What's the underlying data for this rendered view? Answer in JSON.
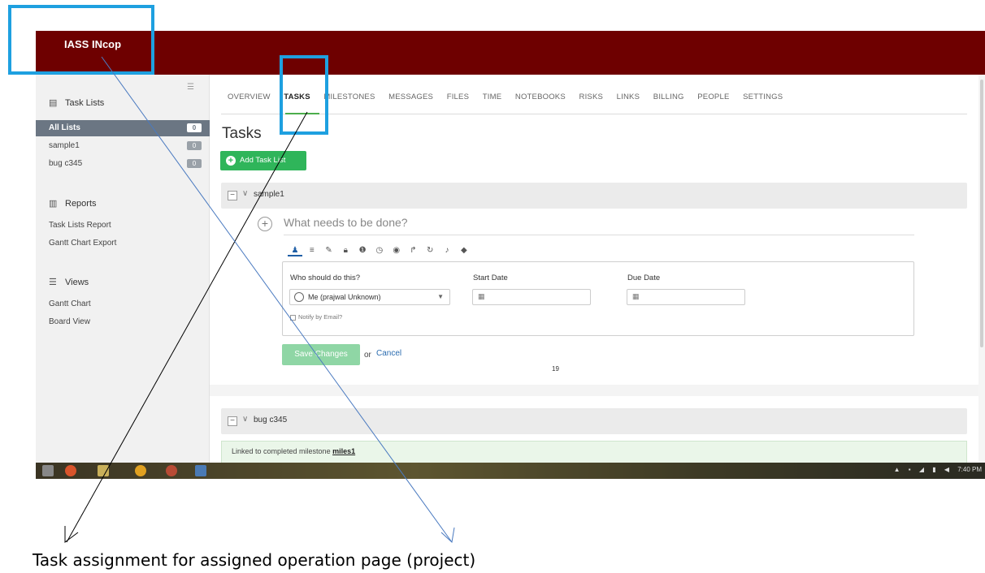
{
  "app": {
    "title": "IASS INcop"
  },
  "sidebar": {
    "sections": [
      {
        "icon": "clipboard-icon",
        "label": "Task Lists"
      },
      {
        "icon": "bar-chart-icon",
        "label": "Reports"
      },
      {
        "icon": "list-icon",
        "label": "Views"
      }
    ],
    "task_lists": [
      {
        "label": "All Lists",
        "count": "0"
      },
      {
        "label": "sample1",
        "count": "0"
      },
      {
        "label": "bug c345",
        "count": "0"
      }
    ],
    "reports": [
      "Task Lists Report",
      "Gantt Chart Export"
    ],
    "views": [
      "Gantt Chart",
      "Board View"
    ]
  },
  "tabs": [
    "OVERVIEW",
    "TASKS",
    "MILESTONES",
    "MESSAGES",
    "FILES",
    "TIME",
    "NOTEBOOKS",
    "RISKS",
    "LINKS",
    "BILLING",
    "PEOPLE",
    "SETTINGS"
  ],
  "active_tab": "TASKS",
  "main": {
    "title": "Tasks",
    "add_button": "Add Task List",
    "list1": {
      "name": "sample1",
      "task_placeholder": "What needs to be done?",
      "who_label": "Who should do this?",
      "assignee": "Me (prajwal Unknown)",
      "start_label": "Start Date",
      "due_label": "Due Date",
      "notify_label": "Notify by Email?",
      "save_button": "Save Changes",
      "or_text": "or",
      "cancel_link": "Cancel"
    },
    "page_number": "19",
    "list2": {
      "name": "bug c345",
      "linked_text": "Linked to completed milestone",
      "milestone_link": "miles1"
    }
  },
  "taskbar": {
    "time": "7:40 PM"
  },
  "colors": {
    "header": "#6e0000",
    "accent_green": "#2fb55a",
    "highlight": "#1ea0e0"
  },
  "annotation": {
    "caption": "Task assignment for assigned operation page (project)"
  }
}
